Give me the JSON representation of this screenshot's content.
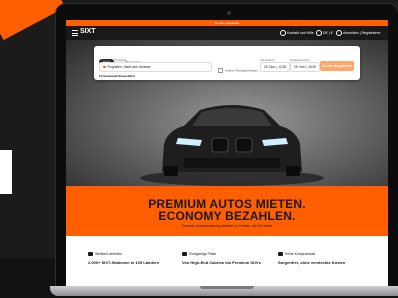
{
  "colors": {
    "brand_orange": "#ff5f00",
    "dark": "#191919",
    "cta_disabled": "#ffa66b"
  },
  "top_strip": {
    "text": "Zu den Angeboten"
  },
  "header": {
    "logo": "SIXT",
    "items": [
      {
        "label": "Kontakt und Hilfe",
        "icon": "help-icon"
      },
      {
        "label": "DE | €",
        "icon": "globe-icon"
      },
      {
        "label": "Anmelden | Registrieren",
        "icon": "user-icon"
      }
    ]
  },
  "booking": {
    "tabs": [
      "PKW",
      "Transporter"
    ],
    "pickup_label": "Abholung & Rückgabe",
    "pickup_placeholder": "Flughafen, Stadt oder Adresse",
    "return_checkbox": "Andere Rückgabestation",
    "pickup_date_label": "Abholdatum",
    "pickup_date": "25. Nov. | 12:30",
    "return_date_label": "Rückgabedatum",
    "return_date": "25. Nov. | 16:00",
    "cta": "Zu den Angeboten",
    "note": "Firmenkunde/Gewerblich"
  },
  "banner": {
    "headline_line1": "PREMIUM AUTOS MIETEN.",
    "headline_line2": "ECONOMY BEZAHLEN.",
    "subline": "Premium-Autovermietung weltweit zu Preisen, die Sie lieben"
  },
  "features": [
    {
      "heading": "Weltweit vertreten",
      "text": "2.000+ SIXT-Stationen in 105 Ländern",
      "icon": "globe-icon"
    },
    {
      "heading": "Einzigartige Flotte",
      "text": "Von High-End Cabrios bis Premium SUVs",
      "icon": "car-icon"
    },
    {
      "heading": "Keine Kompromisse",
      "text": "Sorgenfrei, ohne versteckte Kosten",
      "icon": "checkmark-icon"
    }
  ]
}
